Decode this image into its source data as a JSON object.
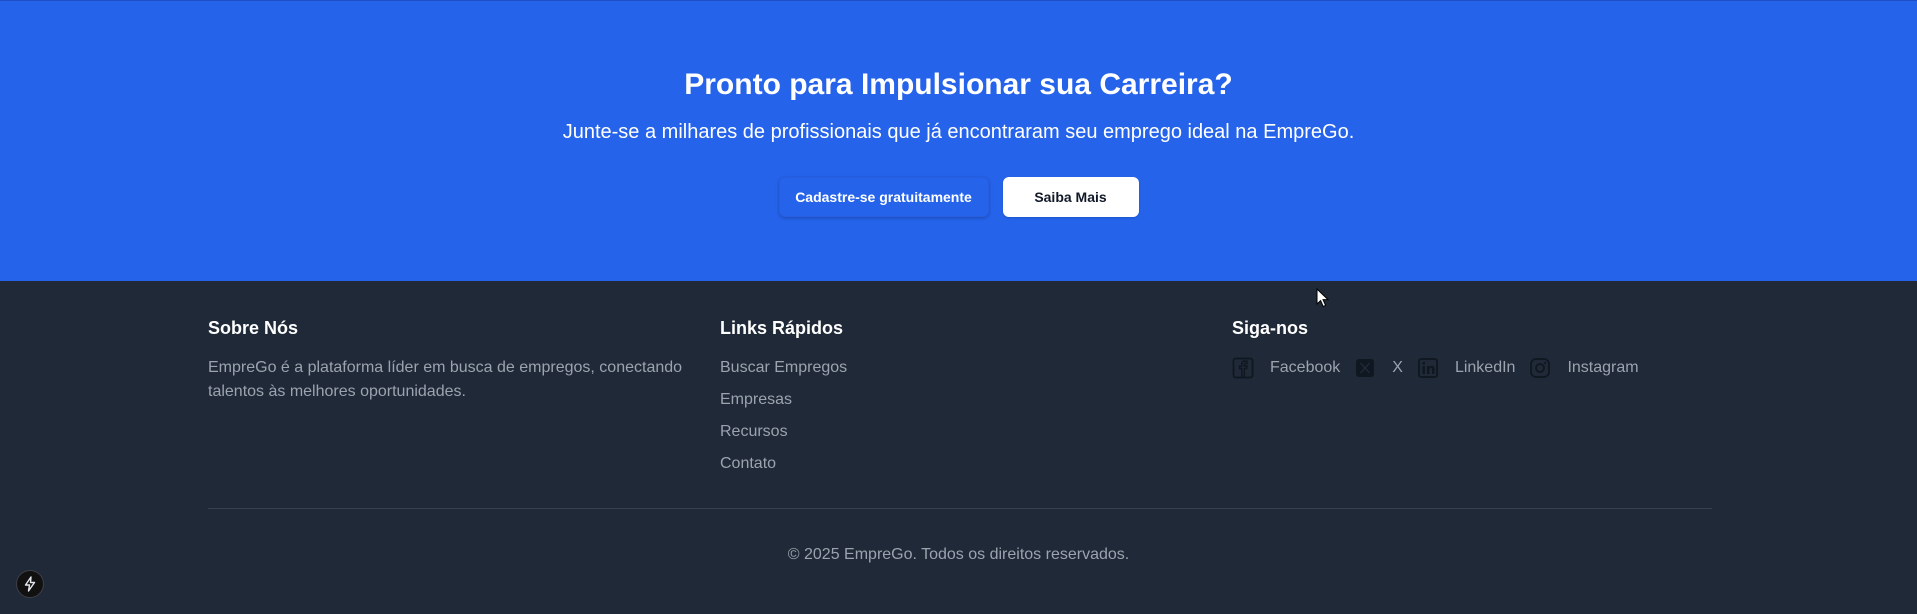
{
  "cta": {
    "title": "Pronto para Impulsionar sua Carreira?",
    "subtitle": "Junte-se a milhares de profissionais que já encontraram seu emprego ideal na EmpreGo.",
    "primary_button": "Cadastre-se gratuitamente",
    "secondary_button": "Saiba Mais"
  },
  "footer": {
    "about": {
      "title": "Sobre Nós",
      "text": "EmpreGo é a plataforma líder em busca de empregos, conectando talentos às melhores oportunidades."
    },
    "quick_links": {
      "title": "Links Rápidos",
      "items": [
        "Buscar Empregos",
        "Empresas",
        "Recursos",
        "Contato"
      ]
    },
    "social": {
      "title": "Siga-nos",
      "items": [
        {
          "label": "Facebook",
          "icon": "facebook-icon"
        },
        {
          "label": "X",
          "icon": "x-icon"
        },
        {
          "label": "LinkedIn",
          "icon": "linkedin-icon"
        },
        {
          "label": "Instagram",
          "icon": "instagram-icon"
        }
      ]
    },
    "copyright": "© 2025 EmpreGo. Todos os direitos reservados."
  },
  "colors": {
    "cta_background": "#2563eb",
    "footer_background": "#1f2937",
    "muted_text": "#9ca3af"
  }
}
